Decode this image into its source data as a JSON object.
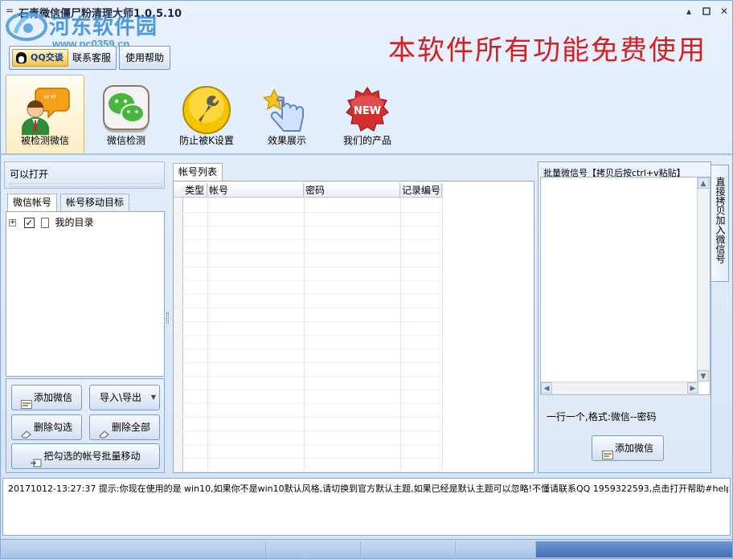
{
  "window": {
    "title_glyph": "=",
    "title": "石青微信僵尸粉清理大师1.0.5.10",
    "minimize": "▴",
    "close": "✕"
  },
  "watermark": {
    "name": "河东软件园",
    "url": "www.pc0359.cn"
  },
  "toolbar": {
    "qq_label": "QQ交谈",
    "service_label": "联系客服",
    "help_label": "使用帮助"
  },
  "banner": "本软件所有功能免费使用",
  "ribbon": [
    {
      "label": "被检测微信",
      "icon": "user-chat-icon",
      "active": true
    },
    {
      "label": "微信检测",
      "icon": "wechat-icon"
    },
    {
      "label": "防止被K设置",
      "icon": "wrench-icon"
    },
    {
      "label": "效果展示",
      "icon": "pointer-icon"
    },
    {
      "label": "我们的产品",
      "icon": "new-badge-icon"
    }
  ],
  "left_panel": {
    "status": "可以打开",
    "tabs": [
      "微信帐号",
      "帐号移动目标"
    ],
    "tree_item": "我的目录",
    "tree_plus": "+",
    "tree_check": "✓",
    "buttons": {
      "add": "添加微信",
      "import_export": "导入\\导出",
      "delete_checked": "删除勾选",
      "delete_all": "删除全部",
      "batch_move": "把勾选的帐号批量移动"
    }
  },
  "grid": {
    "tab": "帐号列表",
    "columns": [
      "类型",
      "帐号",
      "密码",
      "记录编号"
    ]
  },
  "right_panel": {
    "title": "批量微信号【拷贝后按ctrl+v粘贴】",
    "hint": "一行一个,格式:微信--密码",
    "add_button": "添加微信",
    "side_tab": "直接拷贝加入微信号"
  },
  "log": {
    "message": "20171012-13:27:37  提示:你现在使用的是 win10,如果你不是win10默认风格,请切换到官方默认主题,如果已经是默认主题可以忽略!不懂请联系QQ 1959322593,点击打开帮助#help"
  },
  "colors": {
    "banner": "#d42020",
    "accent": "#2f8bd8"
  }
}
